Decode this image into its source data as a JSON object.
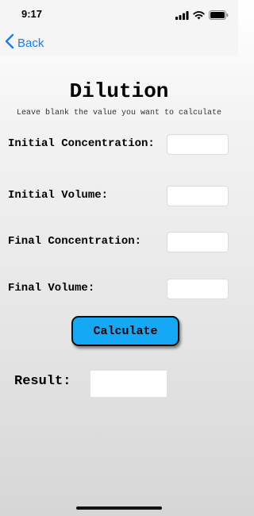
{
  "status_bar": {
    "time": "9:17"
  },
  "nav": {
    "back_label": "Back"
  },
  "page": {
    "title": "Dilution",
    "subtitle": "Leave blank the value you want to calculate"
  },
  "fields": [
    {
      "label": "Initial Concentration:",
      "value": "",
      "placeholder": ""
    },
    {
      "label": "Initial Volume:",
      "value": "",
      "placeholder": ""
    },
    {
      "label": "Final Concentration:",
      "value": "",
      "placeholder": ""
    },
    {
      "label": "Final Volume:",
      "value": "",
      "placeholder": ""
    }
  ],
  "actions": {
    "calculate_label": "Calculate"
  },
  "result": {
    "label": "Result:",
    "value": ""
  },
  "colors": {
    "accent": "#1a7cf5",
    "button": "#15a8f4"
  },
  "icons": {
    "back": "chevron-left-icon",
    "signal": "signal-icon",
    "wifi": "wifi-icon",
    "battery": "battery-icon"
  }
}
